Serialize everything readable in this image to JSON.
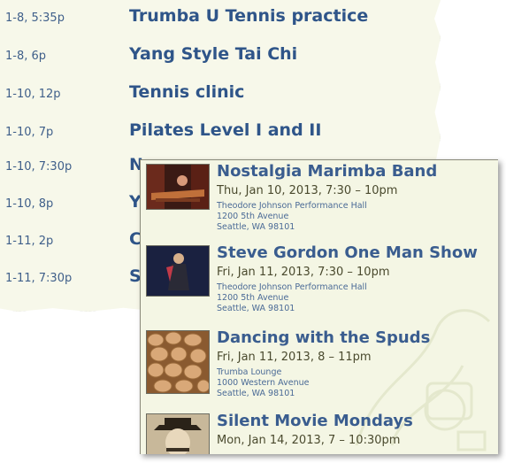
{
  "schedule": [
    {
      "time": "1-8, 5:35p",
      "title": "Trumba U Tennis practice"
    },
    {
      "time": "1-8, 6p",
      "title": "Yang Style Tai Chi"
    },
    {
      "time": "1-10, 12p",
      "title": "Tennis clinic"
    },
    {
      "time": "1-10, 7p",
      "title": "Pilates Level I and II"
    },
    {
      "time": "1-10, 7:30p",
      "title": "N"
    },
    {
      "time": "1-10, 8p",
      "title": "Y"
    },
    {
      "time": "1-11, 2p",
      "title": "C"
    },
    {
      "time": "1-11, 7:30p",
      "title": "S"
    }
  ],
  "events": [
    {
      "title": "Nostalgia Marimba Band",
      "date": "Thu, Jan 10, 2013, 7:30 – 10pm",
      "venue": "Theodore Johnson Performance Hall",
      "street": "1200 5th Avenue",
      "city": "Seattle, WA 98101",
      "thumb": "marimba-photo"
    },
    {
      "title": "Steve Gordon One Man Show",
      "date": "Fri, Jan 11, 2013, 7:30 – 10pm",
      "venue": "Theodore Johnson Performance Hall",
      "street": "1200 5th Avenue",
      "city": "Seattle, WA 98101",
      "thumb": "performer-photo"
    },
    {
      "title": "Dancing with the Spuds",
      "date": "Fri, Jan 11, 2013, 8 – 11pm",
      "venue": "Trumba Lounge",
      "street": "1000 Western Avenue",
      "city": "Seattle, WA 98101",
      "thumb": "potatoes-photo"
    },
    {
      "title": "Silent Movie Mondays",
      "date": "Mon, Jan 14, 2013, 7 – 10:30pm",
      "venue": "",
      "street": "",
      "city": "",
      "thumb": "silent-movie-photo"
    }
  ]
}
